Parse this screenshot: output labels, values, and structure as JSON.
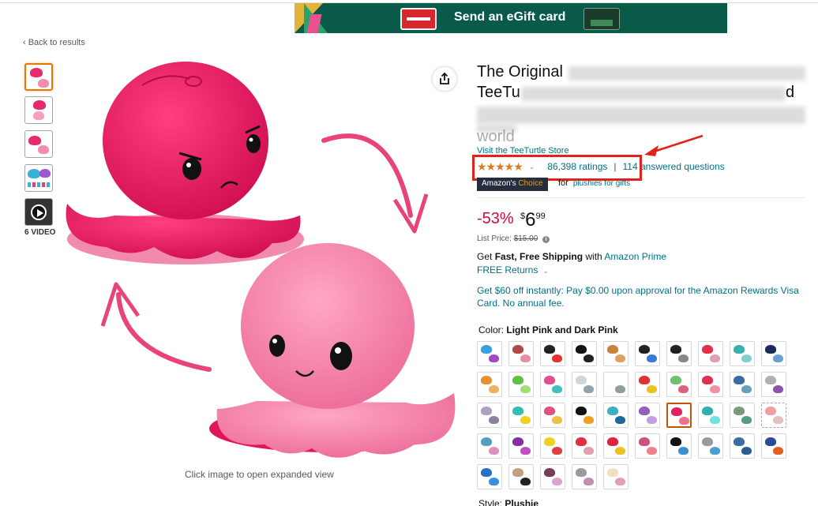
{
  "banner": {
    "text": "Send an eGift card"
  },
  "nav": {
    "back_label": "‹ Back to results"
  },
  "thumbnails": {
    "video_count": "6 VIDEO",
    "items": [
      {
        "c1": "#e8286f",
        "c2": "#f48cab"
      },
      {
        "c1": "#e8286f",
        "c2": "#f7a0bd"
      },
      {
        "c1": "#e8286f",
        "c2": "#f48cab"
      },
      {
        "c1": "#38b2d6",
        "c2": "#9b59d0"
      }
    ]
  },
  "product": {
    "title_visible_prefix": "The Original",
    "title_line2_prefix": "TeeTu",
    "title_line2_suffix": "d",
    "title_line4_suffix": "world",
    "store_link": "Visit the TeeTurtle Store",
    "stars": "★★★★★",
    "ratings": "86,398 ratings",
    "separator": "|",
    "questions": "114 answered questions",
    "badge_prefix": "Amazon's",
    "badge_suffix": "Choice",
    "badge_for": "for",
    "badge_category": "plushies for gifts",
    "discount": "-53%",
    "price_symbol": "$",
    "price_whole": "6",
    "price_fraction": "99",
    "list_price_label": "List Price:",
    "list_price": "$15.00",
    "shipping_get": "Get",
    "shipping_bold": "Fast, Free Shipping",
    "shipping_with": "with",
    "shipping_prime": "Amazon Prime",
    "returns": "FREE Returns",
    "promo": "Get $60 off instantly: Pay $0.00 upon approval for the Amazon Rewards Visa Card. No annual fee.",
    "color_label": "Color:",
    "color_value": "Light Pink and Dark Pink",
    "style_label": "Style:",
    "style_value": "Plushie"
  },
  "image": {
    "caption": "Click image to open expanded view"
  },
  "swatches": [
    [
      "#3aa0e0",
      "#a347c9"
    ],
    [
      "#b04a4a",
      "#e58fa0"
    ],
    [
      "#222222",
      "#e83030"
    ],
    [
      "#111111",
      "#222222"
    ],
    [
      "#c8833a",
      "#e0a060"
    ],
    [
      "#222222",
      "#3a7bd5"
    ],
    [
      "#222222",
      "#888888"
    ],
    [
      "#e0304a",
      "#e0a0b0"
    ],
    [
      "#3ab0b0",
      "#80d0d0"
    ],
    [
      "#1a2b5a",
      "#6aa0d0"
    ],
    [
      "#e89030",
      "#f0b060"
    ],
    [
      "#60c040",
      "#a0e070"
    ],
    [
      "#e05090",
      "#40c0c0"
    ],
    [
      "#cfd8dc",
      "#90a4ae"
    ],
    [
      "#ffffff",
      "#90a090"
    ],
    [
      "#e03030",
      "#f0c020"
    ],
    [
      "#70c070",
      "#e06080"
    ],
    [
      "#e03050",
      "#f090a0"
    ],
    [
      "#3a6ea0",
      "#6a9ec0"
    ],
    [
      "#b0b0b0",
      "#9050b0"
    ],
    [
      "#b0a0c0",
      "#9080a0"
    ],
    [
      "#30c0b0",
      "#f0d020"
    ],
    [
      "#e05080",
      "#f0c040"
    ],
    [
      "#111111",
      "#f0a020"
    ],
    [
      "#3ab0c0",
      "#1a6aa0"
    ],
    [
      "#9060c0",
      "#c0a0e0"
    ],
    [
      "#e02060",
      "#f07090"
    ],
    [
      "#30b0b0",
      "#70e0e0"
    ],
    [
      "#7a9a7a",
      "#50a080"
    ],
    [
      "#f0a0a0",
      "#e0c0c0"
    ],
    [
      "#50a0c0",
      "#e090c0"
    ],
    [
      "#8030a0",
      "#c050c0"
    ],
    [
      "#f0d020",
      "#e04040"
    ],
    [
      "#e03040",
      "#e0a0b0"
    ],
    [
      "#e02040",
      "#f0c020"
    ],
    [
      "#d05080",
      "#f08090"
    ],
    [
      "#111111",
      "#3a90d0"
    ],
    [
      "#9a9aa0",
      "#4aa0d0"
    ],
    [
      "#3a6ea0",
      "#2a5e90"
    ],
    [
      "#2a4a9a",
      "#e06020"
    ],
    [
      "#2a70c0",
      "#3a90e0"
    ],
    [
      "#c0a080",
      "#222222"
    ],
    [
      "#7a3a5a",
      "#e0a0d0"
    ],
    [
      "#9a9aa0",
      "#c090b0"
    ],
    [
      "#f0e0c0",
      "#e0a0b0"
    ]
  ]
}
